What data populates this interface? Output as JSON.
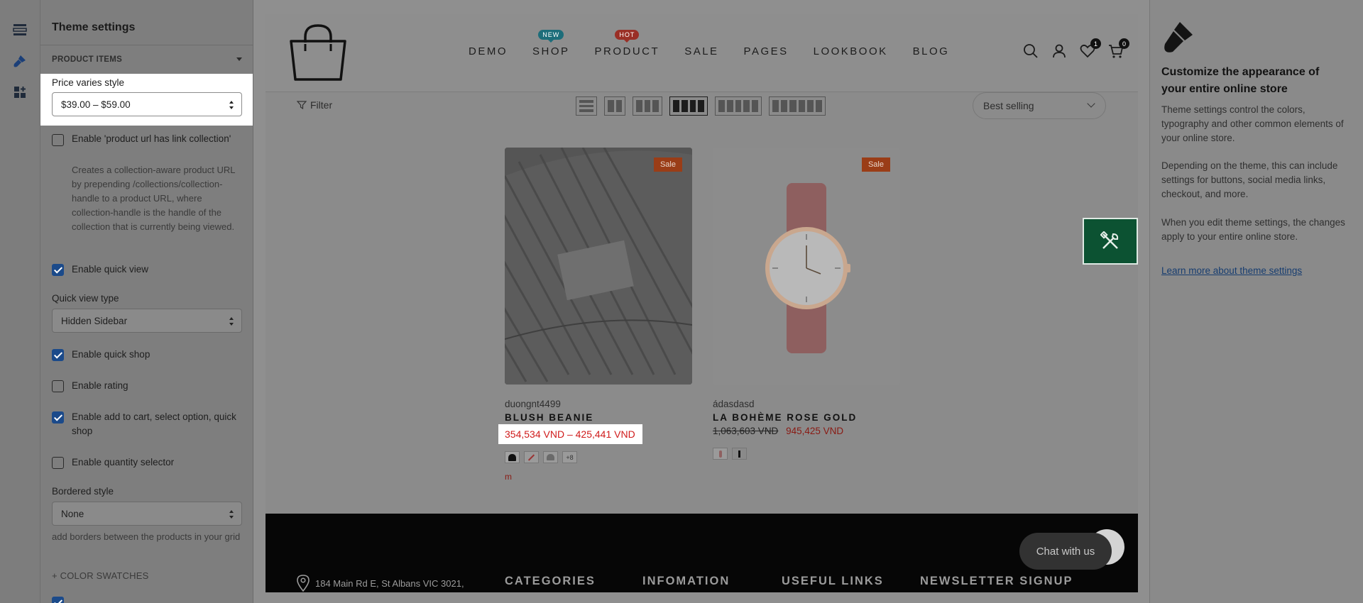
{
  "sidebar_rail": {
    "items": [
      "sections-icon",
      "theme-settings-icon",
      "app-blocks-icon"
    ]
  },
  "panel": {
    "title": "Theme settings",
    "section": "PRODUCT ITEMS",
    "price_varies": {
      "label": "Price varies style",
      "value": "$39.00 – $59.00"
    },
    "product_url": {
      "label": "Enable 'product url has link collection'",
      "checked": false,
      "help": "Creates a collection-aware product URL by prepending /collections/collection-handle to a product URL, where collection-handle is the handle of the collection that is currently being viewed."
    },
    "quick_view": {
      "label": "Enable quick view",
      "checked": true
    },
    "quick_view_type": {
      "label": "Quick view type",
      "value": "Hidden Sidebar"
    },
    "quick_shop": {
      "label": "Enable quick shop",
      "checked": true
    },
    "rating": {
      "label": "Enable rating",
      "checked": false
    },
    "add_to_cart": {
      "label": "Enable add to cart, select option, quick shop",
      "checked": true
    },
    "qty_selector": {
      "label": "Enable quantity selector",
      "checked": false
    },
    "bordered_style": {
      "label": "Bordered style",
      "value": "None",
      "help": "add borders between the products in your grid"
    },
    "color_swatches": "+ COLOR SWATCHES"
  },
  "store": {
    "nav": [
      {
        "label": "DEMO"
      },
      {
        "label": "SHOP",
        "badge": "NEW"
      },
      {
        "label": "PRODUCT",
        "badge": "HOT"
      },
      {
        "label": "SALE"
      },
      {
        "label": "PAGES"
      },
      {
        "label": "LOOKBOOK"
      },
      {
        "label": "BLOG"
      }
    ],
    "wishlist_count": "1",
    "cart_count": "0",
    "filter_label": "Filter",
    "sort_value": "Best selling",
    "products": [
      {
        "badge": "Sale",
        "vendor": "duongnt4499",
        "name": "BLUSH BEANIE",
        "price": "354,534 VND – 425,441 VND",
        "swatch_more": "+8",
        "extra": "m"
      },
      {
        "badge": "Sale",
        "vendor": "ádasdasd",
        "name": "LA BOHÈME ROSE GOLD",
        "old_price": "1,063,603 VND",
        "price": "945,425 VND"
      }
    ],
    "footer": {
      "address": "184 Main Rd E, St Albans VIC 3021,",
      "columns": [
        "CATEGORIES",
        "INFOMATION",
        "USEFUL LINKS",
        "NEWSLETTER SIGNUP"
      ],
      "chat": "Chat with us"
    }
  },
  "info": {
    "title": "Customize the appearance of your entire online store",
    "p1": "Theme settings control the colors, typography and other common elements of your online store.",
    "p2": "Depending on the theme, this can include settings for buttons, social media links, checkout, and more.",
    "p3": "When you edit theme settings, the changes apply to your entire online store.",
    "link": "Learn more about theme settings"
  },
  "colors": {
    "accent_blue": "#1b4a8a",
    "sale_red": "#d01b1b",
    "tools_green": "#0c5232"
  }
}
